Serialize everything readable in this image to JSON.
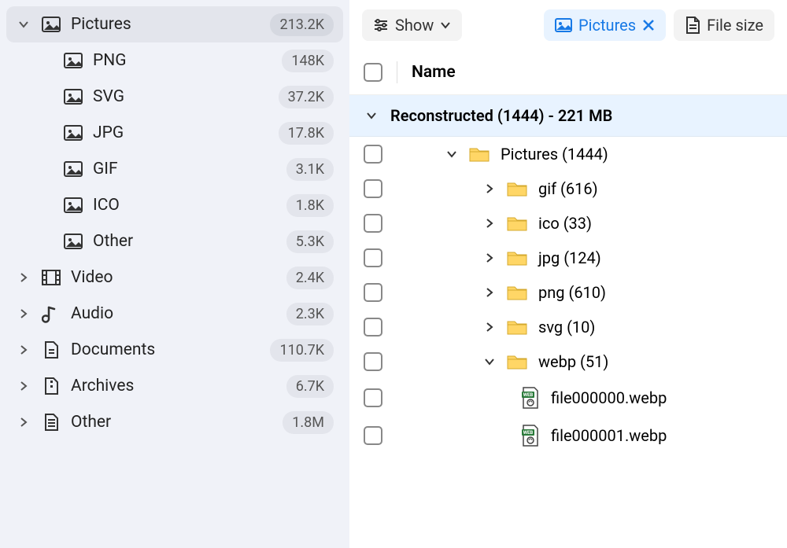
{
  "sidebar": {
    "items": [
      {
        "label": "Pictures",
        "count": "213.2K",
        "expanded": true,
        "active": true,
        "icon": "picture"
      },
      {
        "label": "PNG",
        "count": "148K",
        "indent": 1,
        "icon": "picture"
      },
      {
        "label": "SVG",
        "count": "37.2K",
        "indent": 1,
        "icon": "picture"
      },
      {
        "label": "JPG",
        "count": "17.8K",
        "indent": 1,
        "icon": "picture"
      },
      {
        "label": "GIF",
        "count": "3.1K",
        "indent": 1,
        "icon": "picture"
      },
      {
        "label": "ICO",
        "count": "1.8K",
        "indent": 1,
        "icon": "picture"
      },
      {
        "label": "Other",
        "count": "5.3K",
        "indent": 1,
        "icon": "picture"
      },
      {
        "label": "Video",
        "count": "2.4K",
        "icon": "video"
      },
      {
        "label": "Audio",
        "count": "2.3K",
        "icon": "audio"
      },
      {
        "label": "Documents",
        "count": "110.7K",
        "icon": "document"
      },
      {
        "label": "Archives",
        "count": "6.7K",
        "icon": "archive"
      },
      {
        "label": "Other",
        "count": "1.8M",
        "icon": "other"
      }
    ]
  },
  "toolbar": {
    "show": "Show",
    "pictures": "Pictures",
    "filesize": "File size"
  },
  "header": {
    "name": "Name"
  },
  "group": {
    "label": "Reconstructed (1444) - 221 MB"
  },
  "rows": [
    {
      "label": "Pictures (1444)",
      "icon": "folder",
      "indent": 0,
      "chev": "down"
    },
    {
      "label": "gif (616)",
      "icon": "folder",
      "indent": 1,
      "chev": "right"
    },
    {
      "label": "ico (33)",
      "icon": "folder",
      "indent": 1,
      "chev": "right"
    },
    {
      "label": "jpg (124)",
      "icon": "folder",
      "indent": 1,
      "chev": "right"
    },
    {
      "label": "png (610)",
      "icon": "folder",
      "indent": 1,
      "chev": "right"
    },
    {
      "label": "svg (10)",
      "icon": "folder",
      "indent": 1,
      "chev": "right"
    },
    {
      "label": "webp (51)",
      "icon": "folder",
      "indent": 1,
      "chev": "down"
    },
    {
      "label": "file000000.webp",
      "icon": "file",
      "indent": 2
    },
    {
      "label": "file000001.webp",
      "icon": "file",
      "indent": 2
    }
  ]
}
